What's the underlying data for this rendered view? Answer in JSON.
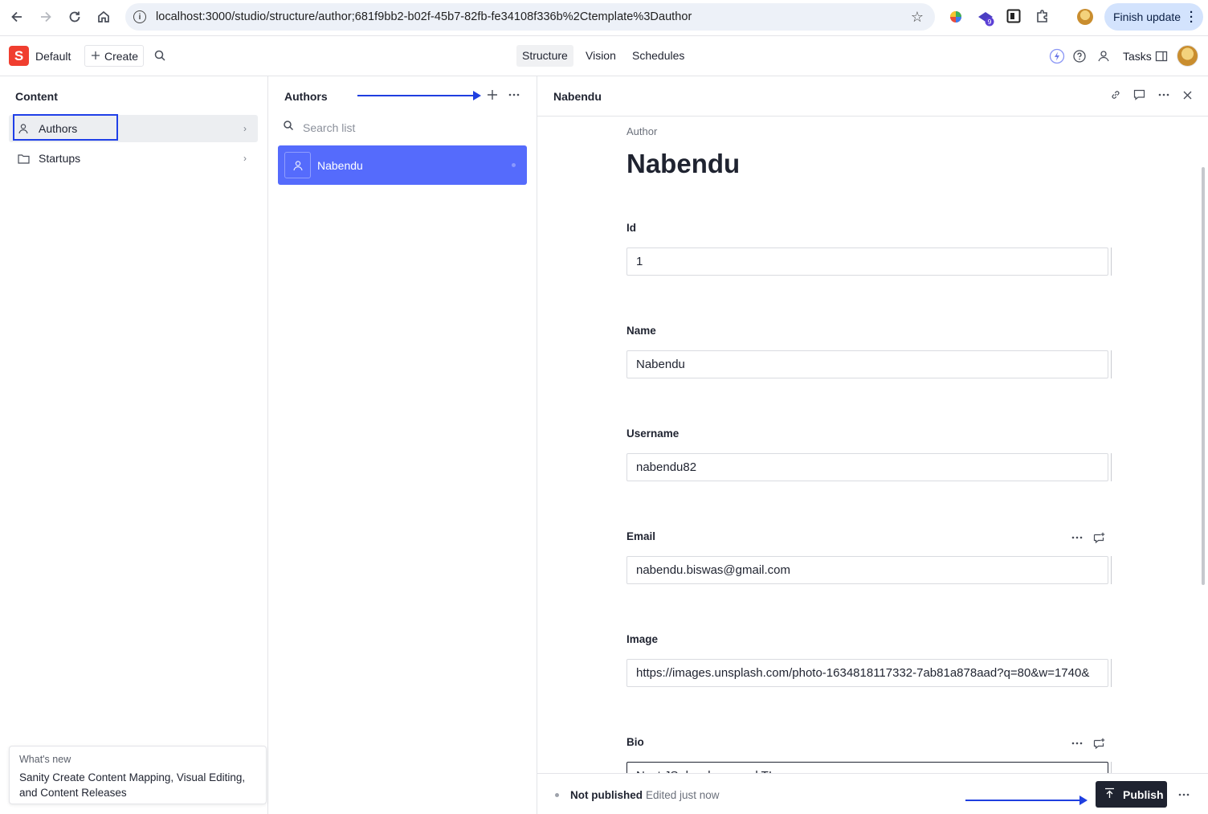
{
  "browser": {
    "url": "localhost:3000/studio/structure/author;681f9bb2-b02f-45b7-82fb-fe34108f336b%2Ctemplate%3Dauthor",
    "finish_update_label": "Finish update",
    "extension_badge": "9"
  },
  "studio": {
    "logo_letter": "S",
    "workspace": "Default",
    "create_label": "Create",
    "tools": [
      "Structure",
      "Vision",
      "Schedules"
    ],
    "active_tool": "Structure",
    "tasks_label": "Tasks"
  },
  "content_pane": {
    "title": "Content",
    "items": [
      {
        "label": "Authors",
        "icon": "user-icon",
        "selected": true
      },
      {
        "label": "Startups",
        "icon": "folder-icon",
        "selected": false
      }
    ],
    "whats_new": {
      "kicker": "What's new",
      "message": "Sanity Create Content Mapping, Visual Editing, and Content Releases"
    }
  },
  "authors_pane": {
    "title": "Authors",
    "search_placeholder": "Search list",
    "documents": [
      {
        "title": "Nabendu",
        "icon": "user-icon",
        "selected": true
      }
    ]
  },
  "document_pane": {
    "title": "Nabendu",
    "type_label": "Author",
    "heading": "Nabendu",
    "fields": [
      {
        "label": "Id",
        "value": "1"
      },
      {
        "label": "Name",
        "value": "Nabendu"
      },
      {
        "label": "Username",
        "value": "nabendu82"
      },
      {
        "label": "Email",
        "value": "nabendu.biswas@gmail.com"
      },
      {
        "label": "Image",
        "value": "https://images.unsplash.com/photo-1634818117332-7ab81a878aad?q=80&w=1740&"
      },
      {
        "label": "Bio",
        "value": "Next JS developer and TI"
      }
    ],
    "status": "Not published",
    "edited": "Edited just now",
    "publish_label": "Publish"
  },
  "colors": {
    "accent": "#556bfc",
    "annotation": "#1f3fe0",
    "brand": "#f03e2f",
    "publish_bg": "#1f2330"
  }
}
